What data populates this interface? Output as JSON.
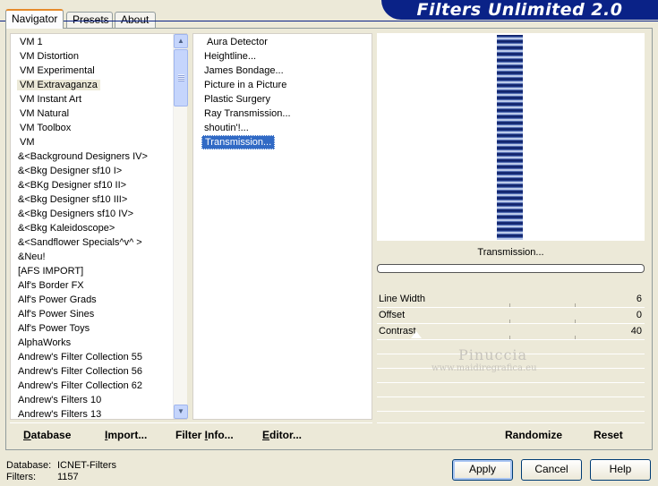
{
  "tabs": [
    {
      "label": "Navigator",
      "active": true
    },
    {
      "label": "Presets",
      "active": false
    },
    {
      "label": "About",
      "active": false
    }
  ],
  "app_title": "Filters Unlimited 2.0",
  "categories": [
    "VM 1",
    "VM Distortion",
    "VM Experimental",
    "VM Extravaganza",
    "VM Instant Art",
    "VM Natural",
    "VM Toolbox",
    "VM",
    "&<Background Designers IV>",
    "&<Bkg Designer sf10 I>",
    "&<BKg Designer sf10 II>",
    "&<Bkg Designer sf10 III>",
    "&<Bkg Designers sf10 IV>",
    "&<Bkg Kaleidoscope>",
    "&<Sandflower Specials^v^ >",
    "&Neu!",
    "[AFS IMPORT]",
    "Alf's Border FX",
    "Alf's Power Grads",
    "Alf's Power Sines",
    "Alf's Power Toys",
    "AlphaWorks",
    "Andrew's Filter Collection 55",
    "Andrew's Filter Collection 56",
    "Andrew's Filter Collection 62",
    "Andrew's Filters 10",
    "Andrew's Filters 13"
  ],
  "selected_category": "VM Extravaganza",
  "filters": [
    "Aura Detector",
    "Heightline...",
    "James Bondage...",
    "Picture in a Picture",
    "Plastic Surgery",
    "Ray Transmission...",
    "shoutin'!...",
    "Transmission..."
  ],
  "selected_filter": "Transmission...",
  "preview": {
    "filter_name": "Transmission...",
    "progress": 0
  },
  "params": [
    {
      "label": "Line Width",
      "value": "6"
    },
    {
      "label": "Offset",
      "value": "0"
    },
    {
      "label": "Contrast",
      "value": "40"
    }
  ],
  "watermark": {
    "name": "Pinuccia",
    "url": "www.maidiregrafica.eu"
  },
  "toolbar": {
    "database": {
      "pre": "",
      "ul": "D",
      "post": "atabase"
    },
    "import": {
      "pre": "",
      "ul": "I",
      "post": "mport..."
    },
    "filter_info": {
      "pre": "Filter ",
      "ul": "I",
      "post": "nfo..."
    },
    "editor": {
      "pre": "",
      "ul": "E",
      "post": "ditor..."
    },
    "randomize": "Randomize",
    "reset": "Reset"
  },
  "status": {
    "database_label": "Database:",
    "database_value": "ICNET-Filters",
    "filters_label": "Filters:",
    "filters_value": "1157"
  },
  "buttons": {
    "apply": "Apply",
    "cancel": "Cancel",
    "help": "Help"
  },
  "colors": {
    "banner": "#0a2287",
    "selection": "#316ac5",
    "face": "#ece9d8"
  }
}
